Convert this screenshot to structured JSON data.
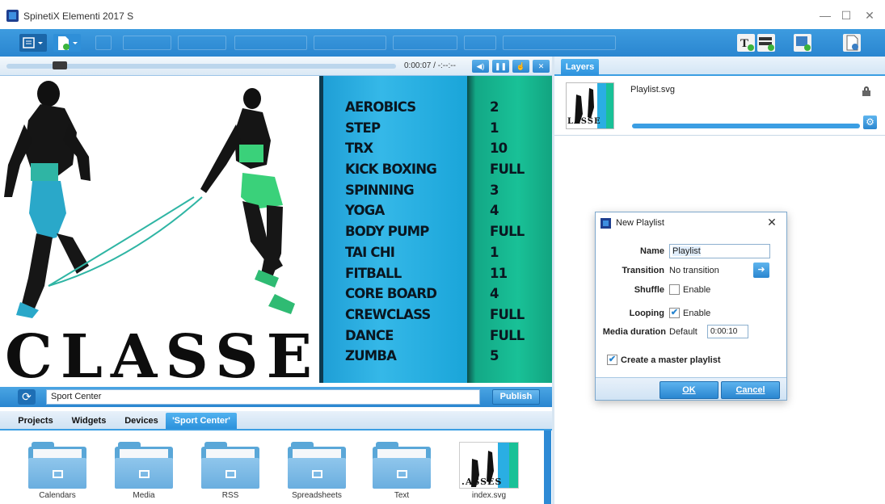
{
  "window": {
    "title": "SpinetiX Elementi 2017 S",
    "minimize": "—",
    "maximize": "☐",
    "close": "✕"
  },
  "player": {
    "time": "0:00:07 / -:--:--",
    "seek_position": 0.13
  },
  "preview": {
    "classes": [
      "AEROBICS",
      "STEP",
      "TRX",
      "KICK BOXING",
      "SPINNING",
      "YOGA",
      "BODY PUMP",
      "TAI CHI",
      "FITBALL",
      "CORE BOARD",
      "CREWCLASS",
      "DANCE",
      "ZUMBA"
    ],
    "values": [
      "2",
      "1",
      "10",
      "FULL",
      "3",
      "4",
      "FULL",
      "1",
      "11",
      "4",
      "FULL",
      "FULL",
      "5"
    ],
    "headline": "CLASSES",
    "colors": {
      "blue": "#2aaee3",
      "green": "#19c197"
    }
  },
  "pathbar": {
    "path": "Sport Center",
    "publish": "Publish"
  },
  "tabs": [
    "Projects",
    "Widgets",
    "Devices",
    "'Sport Center'"
  ],
  "files": [
    {
      "name": "Calendars",
      "icon": "folder-icon"
    },
    {
      "name": "Media",
      "icon": "folder-icon"
    },
    {
      "name": "RSS",
      "icon": "folder-icon"
    },
    {
      "name": "Spreadsheets",
      "icon": "folder-icon"
    },
    {
      "name": "Text",
      "icon": "folder-icon"
    },
    {
      "name": "index.svg",
      "icon": "svg-thumbnail",
      "thumb_text": ".ASSES"
    }
  ],
  "layers": {
    "tab": "Layers",
    "item": {
      "name": "Playlist.svg",
      "thumb_text": "LASSE"
    }
  },
  "dialog": {
    "title": "New Playlist",
    "name_label": "Name",
    "name_value": "Playlist",
    "transition_label": "Transition",
    "transition_value": "No transition",
    "shuffle_label": "Shuffle",
    "shuffle_option": "Enable",
    "shuffle_checked": false,
    "looping_label": "Looping",
    "looping_option": "Enable",
    "looping_checked": true,
    "duration_label": "Media duration",
    "duration_default": "Default",
    "duration_value": "0:00:10",
    "master_label": "Create a master playlist",
    "master_checked": true,
    "ok": "OK",
    "cancel": "Cancel"
  }
}
